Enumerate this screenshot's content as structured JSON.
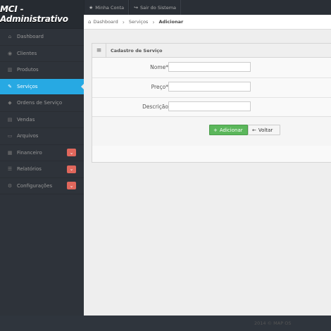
{
  "brand": {
    "title": "MCI - Administrativo"
  },
  "topnav": {
    "items": [
      {
        "label": "Minha Conta",
        "icon": "star-icon"
      },
      {
        "label": "Sair do Sistema",
        "icon": "share-icon"
      }
    ]
  },
  "sidebar": {
    "items": [
      {
        "label": "Dashboard",
        "icon": "home-icon"
      },
      {
        "label": "Clientes",
        "icon": "group-icon"
      },
      {
        "label": "Produtos",
        "icon": "barcode-icon"
      },
      {
        "label": "Serviços",
        "icon": "wrench-icon",
        "active": true
      },
      {
        "label": "Ordens de Serviço",
        "icon": "tags-icon"
      },
      {
        "label": "Vendas",
        "icon": "cart-icon"
      },
      {
        "label": "Arquivos",
        "icon": "hdd-icon"
      },
      {
        "label": "Financeiro",
        "icon": "money-icon",
        "badge": true
      },
      {
        "label": "Relatórios",
        "icon": "list-icon",
        "badge": true
      },
      {
        "label": "Configurações",
        "icon": "cog-icon",
        "badge": true
      }
    ]
  },
  "breadcrumb": {
    "items": [
      "Dashboard",
      "Serviços",
      "Adicionar"
    ]
  },
  "form": {
    "title": "Cadastro de Serviço",
    "fields": [
      {
        "label": "Nome*",
        "value": ""
      },
      {
        "label": "Preço*",
        "value": ""
      },
      {
        "label": "Descrição",
        "value": ""
      }
    ],
    "submit_label": "Adicionar",
    "back_label": "Voltar"
  },
  "footer": {
    "text": "2014 © MAP OS"
  },
  "colors": {
    "accent": "#27a9e3",
    "success": "#5bb75b",
    "badge": "#e0675c"
  }
}
